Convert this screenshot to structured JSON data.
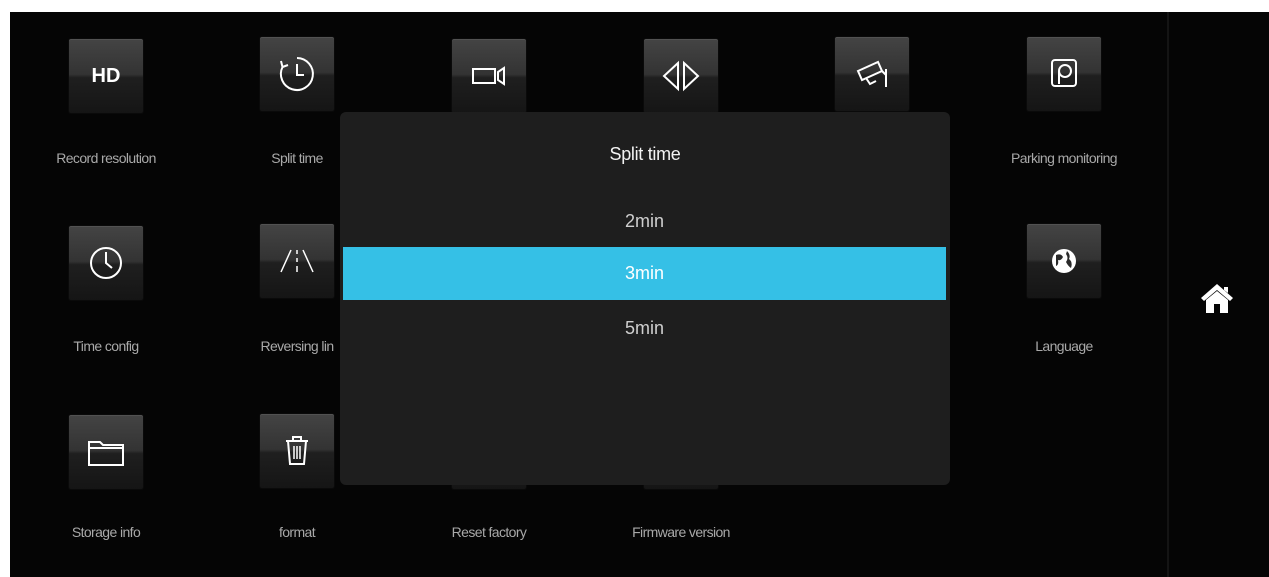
{
  "menu": {
    "items": [
      {
        "id": "record-resolution",
        "label": "Record resolution",
        "icon": "hd-icon",
        "icon_text": "HD"
      },
      {
        "id": "split-time",
        "label": "Split time",
        "icon": "clock-icon"
      },
      {
        "id": "video",
        "label": "",
        "icon": "video-camera-icon"
      },
      {
        "id": "mirror",
        "label": "",
        "icon": "mirror-arrows-icon"
      },
      {
        "id": "surveillance",
        "label": "",
        "icon": "security-camera-icon"
      },
      {
        "id": "parking-monitoring",
        "label": "Parking monitoring",
        "icon": "parking-icon"
      },
      {
        "id": "time-config",
        "label": "Time config",
        "icon": "clock-dial-icon"
      },
      {
        "id": "reversing-line",
        "label": "Reversing lin",
        "icon": "reversing-lines-icon"
      },
      {
        "id": "language",
        "label": "Language",
        "icon": "globe-icon"
      },
      {
        "id": "storage-info",
        "label": "Storage info",
        "icon": "folder-icon"
      },
      {
        "id": "format",
        "label": "format",
        "icon": "trash-icon"
      },
      {
        "id": "reset-factory",
        "label": "Reset factory",
        "icon": "reset-icon"
      },
      {
        "id": "firmware-version",
        "label": "Firmware version",
        "icon": "info-icon"
      }
    ]
  },
  "dialog": {
    "title": "Split time",
    "options": [
      "2min",
      "3min",
      "5min"
    ],
    "selected": "3min"
  },
  "side": {
    "home_icon": "home-icon"
  },
  "colors": {
    "accent": "#35c0e6",
    "background": "#050505",
    "dialog": "#1e1e1e"
  }
}
